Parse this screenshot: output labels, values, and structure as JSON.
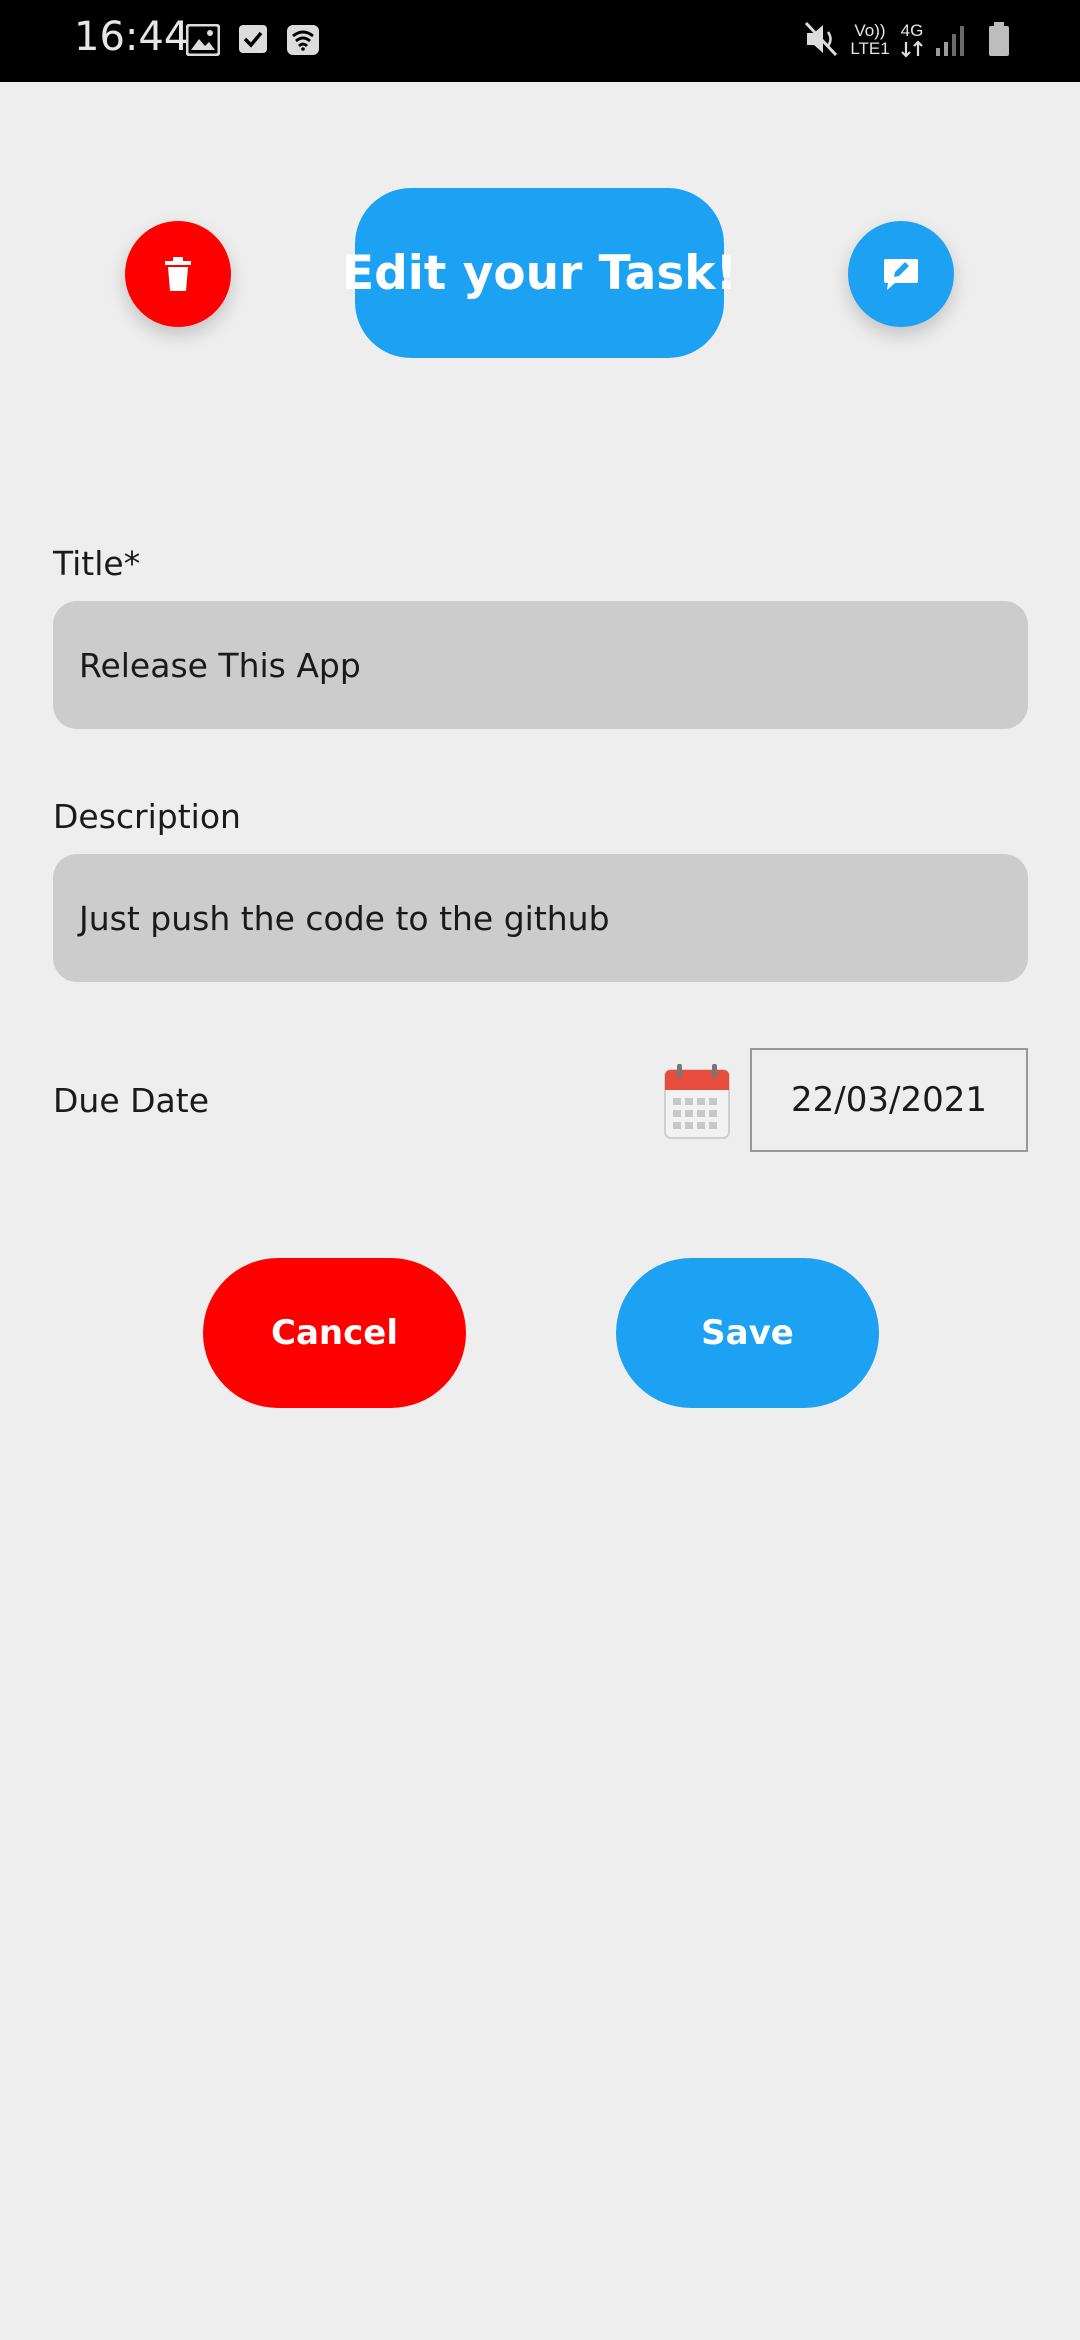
{
  "status_bar": {
    "time": "16:44",
    "volte_label": "Vo))",
    "lte_label": "LTE1",
    "network_label": "4G",
    "icons": [
      "gallery-icon",
      "checkbox-icon",
      "wifi-calling-icon",
      "mute-icon",
      "volte-icon",
      "4g-data-icon",
      "signal-icon",
      "battery-icon"
    ]
  },
  "header": {
    "title": "Edit your Task!",
    "delete_icon": "trash-icon",
    "edit_icon": "edit-message-icon"
  },
  "form": {
    "title_label": "Title*",
    "title_value": "Release This App",
    "description_label": "Description",
    "description_value": "Just push the code to the github",
    "due_date_label": "Due Date",
    "due_date_value": "22/03/2021",
    "calendar_icon": "calendar-icon"
  },
  "actions": {
    "cancel_label": "Cancel",
    "save_label": "Save"
  },
  "colors": {
    "accent_blue": "#1da1f2",
    "danger_red": "#ff0000",
    "background": "#eeeeee",
    "field_bg": "#cccccc"
  }
}
